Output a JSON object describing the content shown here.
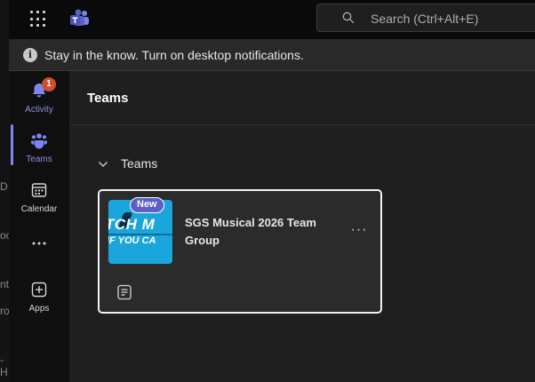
{
  "search": {
    "placeholder": "Search (Ctrl+Alt+E)"
  },
  "banner": {
    "text": "Stay in the know. Turn on desktop notifications."
  },
  "rail": {
    "items": [
      {
        "label": "Activity",
        "badge": "1"
      },
      {
        "label": "Teams"
      },
      {
        "label": "Calendar"
      },
      {
        "label": "Apps"
      }
    ]
  },
  "main": {
    "title": "Teams",
    "section_label": "Teams",
    "card": {
      "tag": "New",
      "name": "SGS Musical 2026 Team Group",
      "thumb_line1": "TCH M",
      "thumb_line2": "IF YOU CA"
    }
  },
  "behind_window": {
    "fragments": [
      "D",
      "oo",
      "nt",
      "ro",
      "-H"
    ]
  },
  "colors": {
    "accent": "#7f85f5",
    "badge": "#d04f2e",
    "thumb": "#1aa6dc"
  }
}
